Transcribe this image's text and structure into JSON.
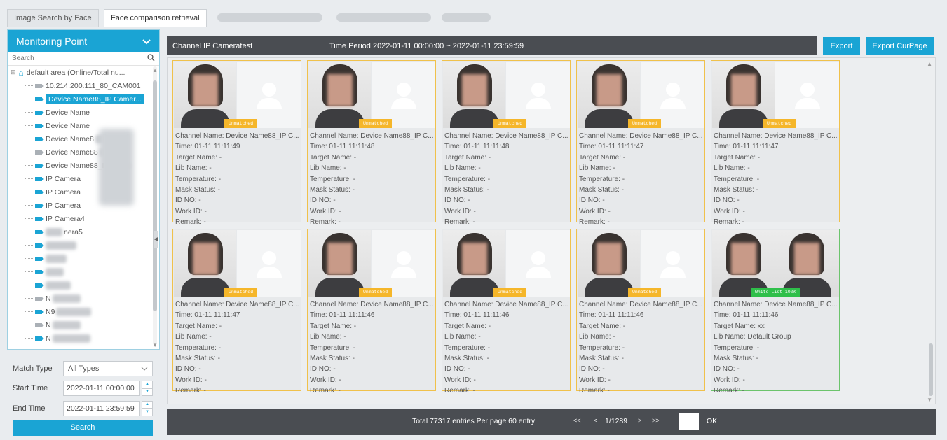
{
  "tabs": [
    {
      "label": "Image Search by Face"
    },
    {
      "label": "Face comparison retrieval"
    }
  ],
  "panel": {
    "title": "Monitoring Point",
    "search_placeholder": "Search",
    "root_label": "default area (Online/Total nu...",
    "tree_items": [
      {
        "label": "10.214.200.111_80_CAM001",
        "online": false
      },
      {
        "label": "Device Name88_IP Camer...",
        "online": true,
        "selected": true
      },
      {
        "label": "Device Name",
        "online": true
      },
      {
        "label": "Device Name",
        "online": true
      },
      {
        "label": "Device Name8",
        "online": true
      },
      {
        "label": "Device Name88",
        "online": false
      },
      {
        "label": "Device Name88_I",
        "online": true
      },
      {
        "label": "IP Camera",
        "online": true
      },
      {
        "label": "IP Camera",
        "online": true
      },
      {
        "label": "IP Camera",
        "online": true
      },
      {
        "label": "IP Camera4",
        "online": true
      },
      {
        "label": "nera5",
        "online": true
      },
      {
        "label": "",
        "online": true
      },
      {
        "label": "",
        "online": true
      },
      {
        "label": "",
        "online": true
      },
      {
        "label": "",
        "online": true
      },
      {
        "label": "N",
        "online": false
      },
      {
        "label": "N9",
        "online": true
      },
      {
        "label": "N",
        "online": false
      },
      {
        "label": "N",
        "online": true
      }
    ]
  },
  "filters": {
    "match_type_label": "Match Type",
    "match_type_value": "All Types",
    "start_time_label": "Start Time",
    "start_time_value": "2022-01-11 00:00:00",
    "end_time_label": "End Time",
    "end_time_value": "2022-01-11 23:59:59",
    "search_button": "Search"
  },
  "header": {
    "channel_text": "Channel  IP Cameratest",
    "time_period_text": "Time Period  2022-01-11 00:00:00  ~  2022-01-11 23:59:59",
    "export_label": "Export",
    "export_curpage_label": "Export CurPage"
  },
  "results": [
    {
      "badge": "Unmatched",
      "channel": "Channel Name: Device Name88_IP C...",
      "time": "Time: 01-11 11:11:49",
      "target": "Target Name: -",
      "lib": "Lib Name: -",
      "temperature": "Temperature: -",
      "mask": "Mask Status: -",
      "id_no": "ID NO: -",
      "work_id": "Work ID: -",
      "remark": "Remark: -"
    },
    {
      "badge": "Unmatched",
      "channel": "Channel Name: Device Name88_IP C...",
      "time": "Time: 01-11 11:11:48",
      "target": "Target Name: -",
      "lib": "Lib Name: -",
      "temperature": "Temperature: -",
      "mask": "Mask Status: -",
      "id_no": "ID NO: -",
      "work_id": "Work ID: -",
      "remark": "Remark: -"
    },
    {
      "badge": "Unmatched",
      "channel": "Channel Name: Device Name88_IP C...",
      "time": "Time: 01-11 11:11:48",
      "target": "Target Name: -",
      "lib": "Lib Name: -",
      "temperature": "Temperature: -",
      "mask": "Mask Status: -",
      "id_no": "ID NO: -",
      "work_id": "Work ID: -",
      "remark": "Remark: -"
    },
    {
      "badge": "Unmatched",
      "channel": "Channel Name: Device Name88_IP C...",
      "time": "Time: 01-11 11:11:47",
      "target": "Target Name: -",
      "lib": "Lib Name: -",
      "temperature": "Temperature: -",
      "mask": "Mask Status: -",
      "id_no": "ID NO: -",
      "work_id": "Work ID: -",
      "remark": "Remark: -"
    },
    {
      "badge": "Unmatched",
      "channel": "Channel Name: Device Name88_IP C...",
      "time": "Time: 01-11 11:11:47",
      "target": "Target Name: -",
      "lib": "Lib Name: -",
      "temperature": "Temperature: -",
      "mask": "Mask Status: -",
      "id_no": "ID NO: -",
      "work_id": "Work ID: -",
      "remark": "Remark: -"
    },
    {
      "badge": "Unmatched",
      "channel": "Channel Name: Device Name88_IP C...",
      "time": "Time: 01-11 11:11:47",
      "target": "Target Name: -",
      "lib": "Lib Name: -",
      "temperature": "Temperature: -",
      "mask": "Mask Status: -",
      "id_no": "ID NO: -",
      "work_id": "Work ID: -",
      "remark": "Remark: -"
    },
    {
      "badge": "Unmatched",
      "channel": "Channel Name: Device Name88_IP C...",
      "time": "Time: 01-11 11:11:46",
      "target": "Target Name: -",
      "lib": "Lib Name: -",
      "temperature": "Temperature: -",
      "mask": "Mask Status: -",
      "id_no": "ID NO: -",
      "work_id": "Work ID: -",
      "remark": "Remark: -"
    },
    {
      "badge": "Unmatched",
      "channel": "Channel Name: Device Name88_IP C...",
      "time": "Time: 01-11 11:11:46",
      "target": "Target Name: -",
      "lib": "Lib Name: -",
      "temperature": "Temperature: -",
      "mask": "Mask Status: -",
      "id_no": "ID NO: -",
      "work_id": "Work ID: -",
      "remark": "Remark: -"
    },
    {
      "badge": "Unmatched",
      "channel": "Channel Name: Device Name88_IP C...",
      "time": "Time: 01-11 11:11:46",
      "target": "Target Name: -",
      "lib": "Lib Name: -",
      "temperature": "Temperature: -",
      "mask": "Mask Status: -",
      "id_no": "ID NO: -",
      "work_id": "Work ID: -",
      "remark": "Remark: -"
    },
    {
      "badge": "White List 100%",
      "matched": true,
      "channel": "Channel Name: Device Name88_IP C...",
      "time": "Time: 01-11 11:11:46",
      "target": "Target Name: xx",
      "lib": "Lib Name: Default Group",
      "temperature": "Temperature: -",
      "mask": "Mask Status: -",
      "id_no": "ID NO: -",
      "work_id": "Work ID: -",
      "remark": "Remark: -"
    }
  ],
  "pagination": {
    "total_text": "Total 77317 entries  Per page 60 entry",
    "first": "<<",
    "prev": "<",
    "page_text": "1/1289",
    "next": ">",
    "last": ">>",
    "ok_label": "OK"
  },
  "colors": {
    "accent": "#1aa4d4",
    "unmatched_badge": "#f5b62a",
    "whitelist_badge": "#2fbf4a",
    "dark_bar": "#4a4d52"
  }
}
